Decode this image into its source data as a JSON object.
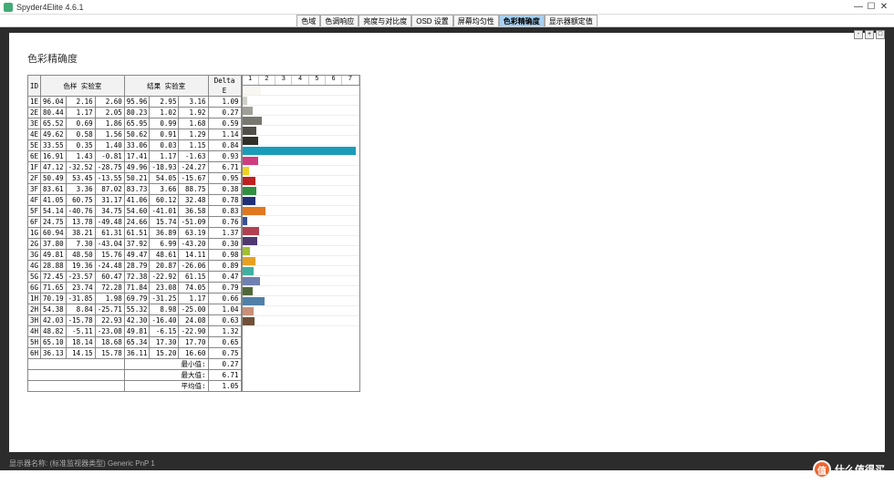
{
  "window": {
    "title": "Spyder4Elite 4.6.1",
    "min": "—",
    "max": "☐",
    "close": "✕"
  },
  "tabs": [
    "色域",
    "色调响应",
    "亮度与对比度",
    "OSD 设置",
    "屏幕均匀性",
    "色彩精确度",
    "显示器额定值"
  ],
  "active_tab": 5,
  "page_title": "色彩精确度",
  "columns": [
    "ID",
    "色样 实验室",
    "",
    "",
    "结果 实验室",
    "",
    "",
    "Delta E"
  ],
  "bar_scale": [
    "1",
    "2",
    "3",
    "4",
    "5",
    "6",
    "7"
  ],
  "rows": [
    {
      "id": "1E",
      "v": [
        96.04,
        2.16,
        2.6,
        95.96,
        2.95,
        3.16
      ],
      "de": 1.09,
      "color": "#f8f8f0"
    },
    {
      "id": "2E",
      "v": [
        80.44,
        1.17,
        2.05,
        80.23,
        1.02,
        1.92
      ],
      "de": 0.27,
      "color": "#d0d0c8"
    },
    {
      "id": "3E",
      "v": [
        65.52,
        0.69,
        1.86,
        65.95,
        0.99,
        1.68
      ],
      "de": 0.59,
      "color": "#a0a098"
    },
    {
      "id": "4E",
      "v": [
        49.62,
        0.58,
        1.56,
        50.62,
        0.91,
        1.29
      ],
      "de": 1.14,
      "color": "#787870"
    },
    {
      "id": "5E",
      "v": [
        33.55,
        0.35,
        1.4,
        33.06,
        0.03,
        1.15
      ],
      "de": 0.84,
      "color": "#505048"
    },
    {
      "id": "6E",
      "v": [
        16.91,
        1.43,
        -0.81,
        17.41,
        1.17,
        -1.63
      ],
      "de": 0.93,
      "color": "#303028"
    },
    {
      "id": "1F",
      "v": [
        47.12,
        -32.52,
        -28.75,
        49.96,
        -18.93,
        -24.27
      ],
      "de": 6.71,
      "color": "#1a9cb8"
    },
    {
      "id": "2F",
      "v": [
        50.49,
        53.45,
        -13.55,
        50.21,
        54.05,
        -15.67
      ],
      "de": 0.95,
      "color": "#d03c80"
    },
    {
      "id": "3F",
      "v": [
        83.61,
        3.36,
        87.02,
        83.73,
        3.66,
        88.75
      ],
      "de": 0.38,
      "color": "#f0d020"
    },
    {
      "id": "4F",
      "v": [
        41.05,
        60.75,
        31.17,
        41.06,
        60.12,
        32.48
      ],
      "de": 0.78,
      "color": "#c02020"
    },
    {
      "id": "5F",
      "v": [
        54.14,
        -40.76,
        34.75,
        54.6,
        -41.01,
        36.58
      ],
      "de": 0.83,
      "color": "#309040"
    },
    {
      "id": "6F",
      "v": [
        24.75,
        13.78,
        -49.48,
        24.66,
        15.74,
        -51.09
      ],
      "de": 0.76,
      "color": "#203078"
    },
    {
      "id": "1G",
      "v": [
        60.94,
        38.21,
        61.31,
        61.51,
        36.89,
        63.19
      ],
      "de": 1.37,
      "color": "#e07820"
    },
    {
      "id": "2G",
      "v": [
        37.8,
        7.3,
        -43.04,
        37.92,
        6.99,
        -43.2
      ],
      "de": 0.3,
      "color": "#3850a0"
    },
    {
      "id": "3G",
      "v": [
        49.81,
        48.5,
        15.76,
        49.47,
        48.61,
        14.11
      ],
      "de": 0.98,
      "color": "#b04050"
    },
    {
      "id": "4G",
      "v": [
        28.88,
        19.36,
        -24.48,
        28.79,
        20.87,
        -26.06
      ],
      "de": 0.89,
      "color": "#503870"
    },
    {
      "id": "5G",
      "v": [
        72.45,
        -23.57,
        60.47,
        72.38,
        -22.92,
        61.15
      ],
      "de": 0.47,
      "color": "#a0c030"
    },
    {
      "id": "6G",
      "v": [
        71.65,
        23.74,
        72.28,
        71.84,
        23.08,
        74.05
      ],
      "de": 0.79,
      "color": "#e8a020"
    },
    {
      "id": "1H",
      "v": [
        70.19,
        -31.85,
        1.98,
        69.79,
        -31.25,
        1.17
      ],
      "de": 0.66,
      "color": "#40b0a0"
    },
    {
      "id": "2H",
      "v": [
        54.38,
        8.84,
        -25.71,
        55.32,
        8.98,
        -25.0
      ],
      "de": 1.04,
      "color": "#7080b0"
    },
    {
      "id": "3H",
      "v": [
        42.03,
        -15.78,
        22.93,
        42.3,
        -16.4,
        24.08
      ],
      "de": 0.63,
      "color": "#506838"
    },
    {
      "id": "4H",
      "v": [
        48.82,
        -5.11,
        -23.08,
        49.81,
        -6.15,
        -22.9
      ],
      "de": 1.32,
      "color": "#5080a8"
    },
    {
      "id": "5H",
      "v": [
        65.1,
        18.14,
        18.68,
        65.34,
        17.3,
        17.7
      ],
      "de": 0.65,
      "color": "#c89078"
    },
    {
      "id": "6H",
      "v": [
        36.13,
        14.15,
        15.78,
        36.11,
        15.2,
        16.6
      ],
      "de": 0.75,
      "color": "#705038"
    }
  ],
  "summary": {
    "min_label": "最小值:",
    "min": 0.27,
    "max_label": "最大值:",
    "max": 6.71,
    "avg_label": "平均值:",
    "avg": 1.05
  },
  "statusbar": "显示器名称: (标准监视器类型) Generic PnP 1",
  "watermark": "什么值得买"
}
